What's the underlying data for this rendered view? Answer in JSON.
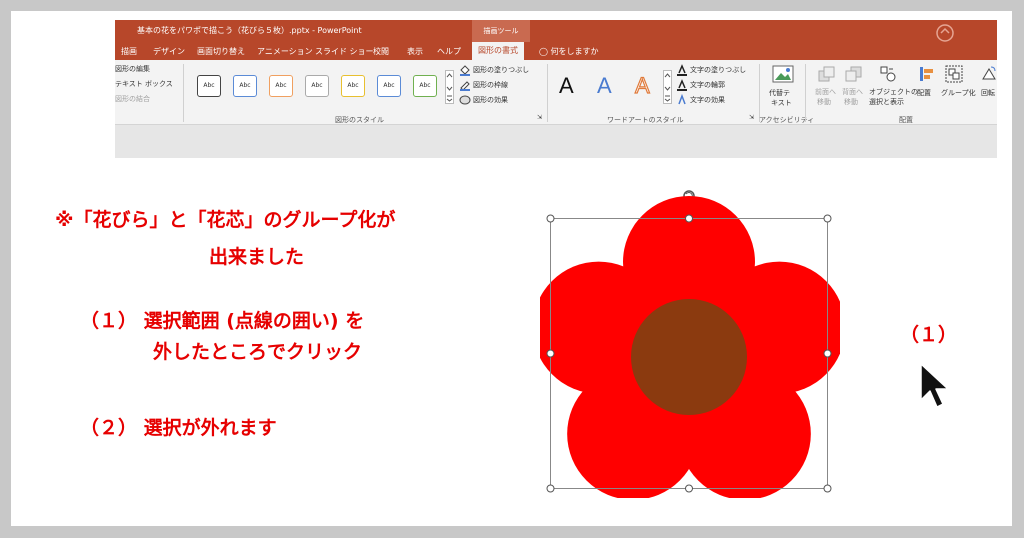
{
  "window": {
    "title": "基本の花をパワポで描こう（花びら５枚）.pptx  -  PowerPoint",
    "context_tab": "描画ツール"
  },
  "tabs": [
    "描画",
    "デザイン",
    "画面切り替え",
    "アニメーション",
    "スライド ショー",
    "校閲",
    "表示",
    "ヘルプ",
    "図形の書式",
    "何をしますか"
  ],
  "ribbon": {
    "insert_group": [
      "図形の編集",
      "テキスト ボックス",
      "図形の結合"
    ],
    "shape_styles": {
      "preset_label": "Abc",
      "options": [
        "図形の塗りつぶし",
        "図形の枠線",
        "図形の効果"
      ],
      "group_label": "図形のスタイル"
    },
    "wordart": {
      "letter": "A",
      "options": [
        "文字の塗りつぶし",
        "文字の輪郭",
        "文字の効果"
      ],
      "group_label": "ワードアートのスタイル"
    },
    "accessibility": {
      "button": "代替テキスト",
      "button_l1": "代替テ",
      "button_l2": "キスト",
      "group_label": "アクセシビリティ"
    },
    "arrange": {
      "items": [
        "前面へ移動",
        "背面へ移動",
        "オブジェクトの選択と表示",
        "配置",
        "グループ化",
        "回転"
      ],
      "item_lines": [
        [
          "前面へ",
          "移動"
        ],
        [
          "背面へ",
          "移動"
        ],
        [
          "オブジェクトの",
          "選択と表示"
        ],
        [
          "配置",
          ""
        ],
        [
          "グループ化",
          ""
        ],
        [
          "回転",
          ""
        ]
      ],
      "group_label": "配置"
    }
  },
  "slide": {
    "note_line1": "※「花びら」と「花芯」のグループ化が",
    "note_line2": "出来ました",
    "step1_line1": "（１）   選択範囲 (点線の囲い) を",
    "step1_line2": "外したところでクリック",
    "step2": "（２）    選択が外れます",
    "marker": "（１）"
  },
  "colors": {
    "petal": "#ff0000",
    "center": "#8b3a0f",
    "text": "#e60000",
    "ribbon_accent": "#b7472a"
  }
}
